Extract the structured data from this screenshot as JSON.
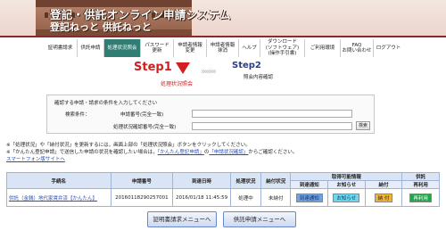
{
  "header": {
    "title": "登記・供託オンライン申請システム",
    "subtitle": "登記ねっと 供託ねっと"
  },
  "nav": [
    {
      "label": "証明書請求",
      "active": false
    },
    {
      "label": "供託申請",
      "active": false
    },
    {
      "label": "処理状況照会",
      "active": true
    },
    {
      "label": "パスワード\n更新",
      "active": false
    },
    {
      "label": "申請者情報\n変更",
      "active": false
    },
    {
      "label": "申請者情報\n抹消",
      "active": false
    },
    {
      "label": "ヘルプ",
      "active": false
    },
    {
      "label": "ダウンロード\n(ソフトウェア)\n(操作手引書)",
      "active": false
    },
    {
      "label": "ご利用環境",
      "active": false
    },
    {
      "label": "FAQ\nお問い合わせ",
      "active": false
    },
    {
      "label": "ログアウト",
      "active": false
    }
  ],
  "steps": {
    "step1_title": "Step1",
    "step1_label": "処理状況照会",
    "step2_title": "Step2",
    "step2_label": "照会内容確認"
  },
  "search": {
    "instruction": "確認する申請・請求の条件を入力してください",
    "condition_label": "検索条件：",
    "field1_label": "申請番号(完全一致)",
    "field2_label": "処理状況確認番号(完全一致)",
    "field1_value": "",
    "field2_value": "",
    "button_label": "検索"
  },
  "notes": {
    "line1": "※「処理状況」や「納付状況」を更新するには，画面上部の「処理状況照会」ボタンをクリックしてください。",
    "line2_pre": "※「かんたん登記申請」で送信した申請の状況を確認したい場合は，",
    "line2_link1": "「かんたん登記申請」",
    "line2_mid": "の",
    "line2_link2": "「申請状況確認」",
    "line2_post": "からご確認ください。",
    "line3": "スマートフォン版サイトへ"
  },
  "table": {
    "headers": {
      "doc_name": "手続名",
      "app_no": "申請番号",
      "arrival": "到達日時",
      "status": "処理状況",
      "payment": "納付状況",
      "obtainable": "取得可能情報",
      "deposit": "供託",
      "arrival_notice": "到達通知",
      "notification": "お知らせ",
      "pay": "納付",
      "reuse": "再利用"
    },
    "rows": [
      {
        "doc_name": "供託（金銭）地代家賃弁済【かんたん】",
        "app_no": "20160118290257001",
        "arrival": "2016/01/18 11:45:59",
        "status": "処理中",
        "payment": "未納付",
        "arrival_btn": "到達通知",
        "notice_btn": "お知らせ",
        "pay_btn": "納 付",
        "reuse_btn": "再利用"
      }
    ]
  },
  "buttons": {
    "cert_menu": "証明書請求メニューへ",
    "deposit_menu": "供託申請メニューへ"
  }
}
